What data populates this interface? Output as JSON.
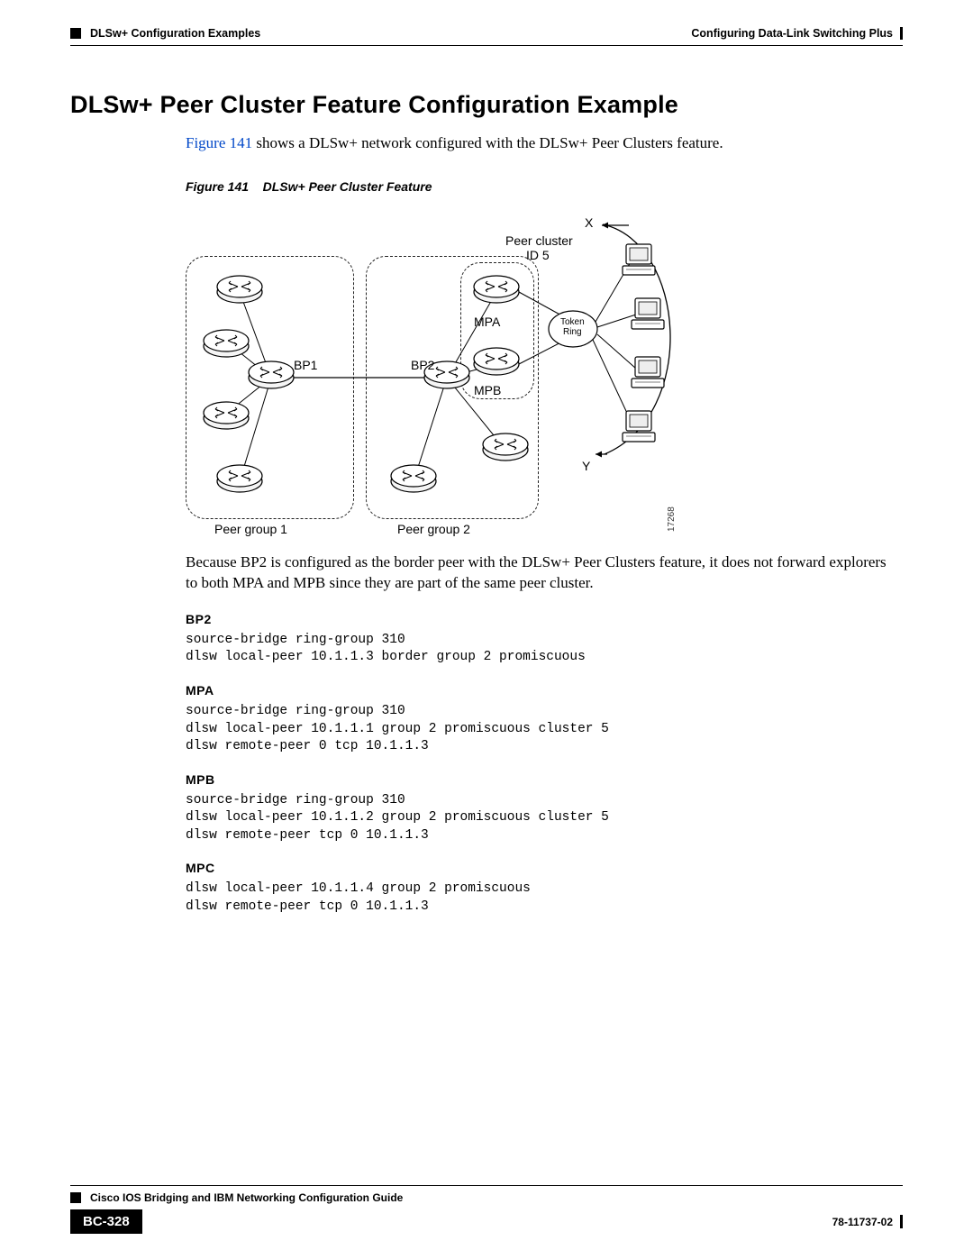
{
  "header": {
    "left": "DLSw+ Configuration Examples",
    "right": "Configuring Data-Link Switching Plus"
  },
  "title": "DLSw+ Peer Cluster Feature Configuration Example",
  "intro": {
    "ref": "Figure 141",
    "rest": " shows a DLSw+ network configured with the DLSw+ Peer Clusters feature."
  },
  "figure": {
    "caption_prefix": "Figure 141",
    "caption_text": "DLSw+ Peer Cluster Feature",
    "labels": {
      "x": "X",
      "y": "Y",
      "peer_cluster": "Peer cluster",
      "id5": "ID 5",
      "mpa": "MPA",
      "mpb": "MPB",
      "bp1": "BP1",
      "bp2": "BP2",
      "token_ring": "Token\nRing",
      "pg1": "Peer group 1",
      "pg2": "Peer group 2",
      "id": "17268"
    }
  },
  "body_para": "Because BP2 is configured as the border peer with the DLSw+ Peer Clusters feature, it does not forward explorers to both MPA and MPB since they are part of the same peer cluster.",
  "configs": [
    {
      "title": "BP2",
      "code": "source-bridge ring-group 310\ndlsw local-peer 10.1.1.3 border group 2 promiscuous"
    },
    {
      "title": "MPA",
      "code": "source-bridge ring-group 310\ndlsw local-peer 10.1.1.1 group 2 promiscuous cluster 5\ndlsw remote-peer 0 tcp 10.1.1.3"
    },
    {
      "title": "MPB",
      "code": "source-bridge ring-group 310\ndlsw local-peer 10.1.1.2 group 2 promiscuous cluster 5\ndlsw remote-peer tcp 0 10.1.1.3"
    },
    {
      "title": "MPC",
      "code": "dlsw local-peer 10.1.1.4 group 2 promiscuous\ndlsw remote-peer tcp 0 10.1.1.3"
    }
  ],
  "footer": {
    "book_title": "Cisco IOS Bridging and IBM Networking Configuration Guide",
    "page_num": "BC-328",
    "doc_num": "78-11737-02"
  }
}
